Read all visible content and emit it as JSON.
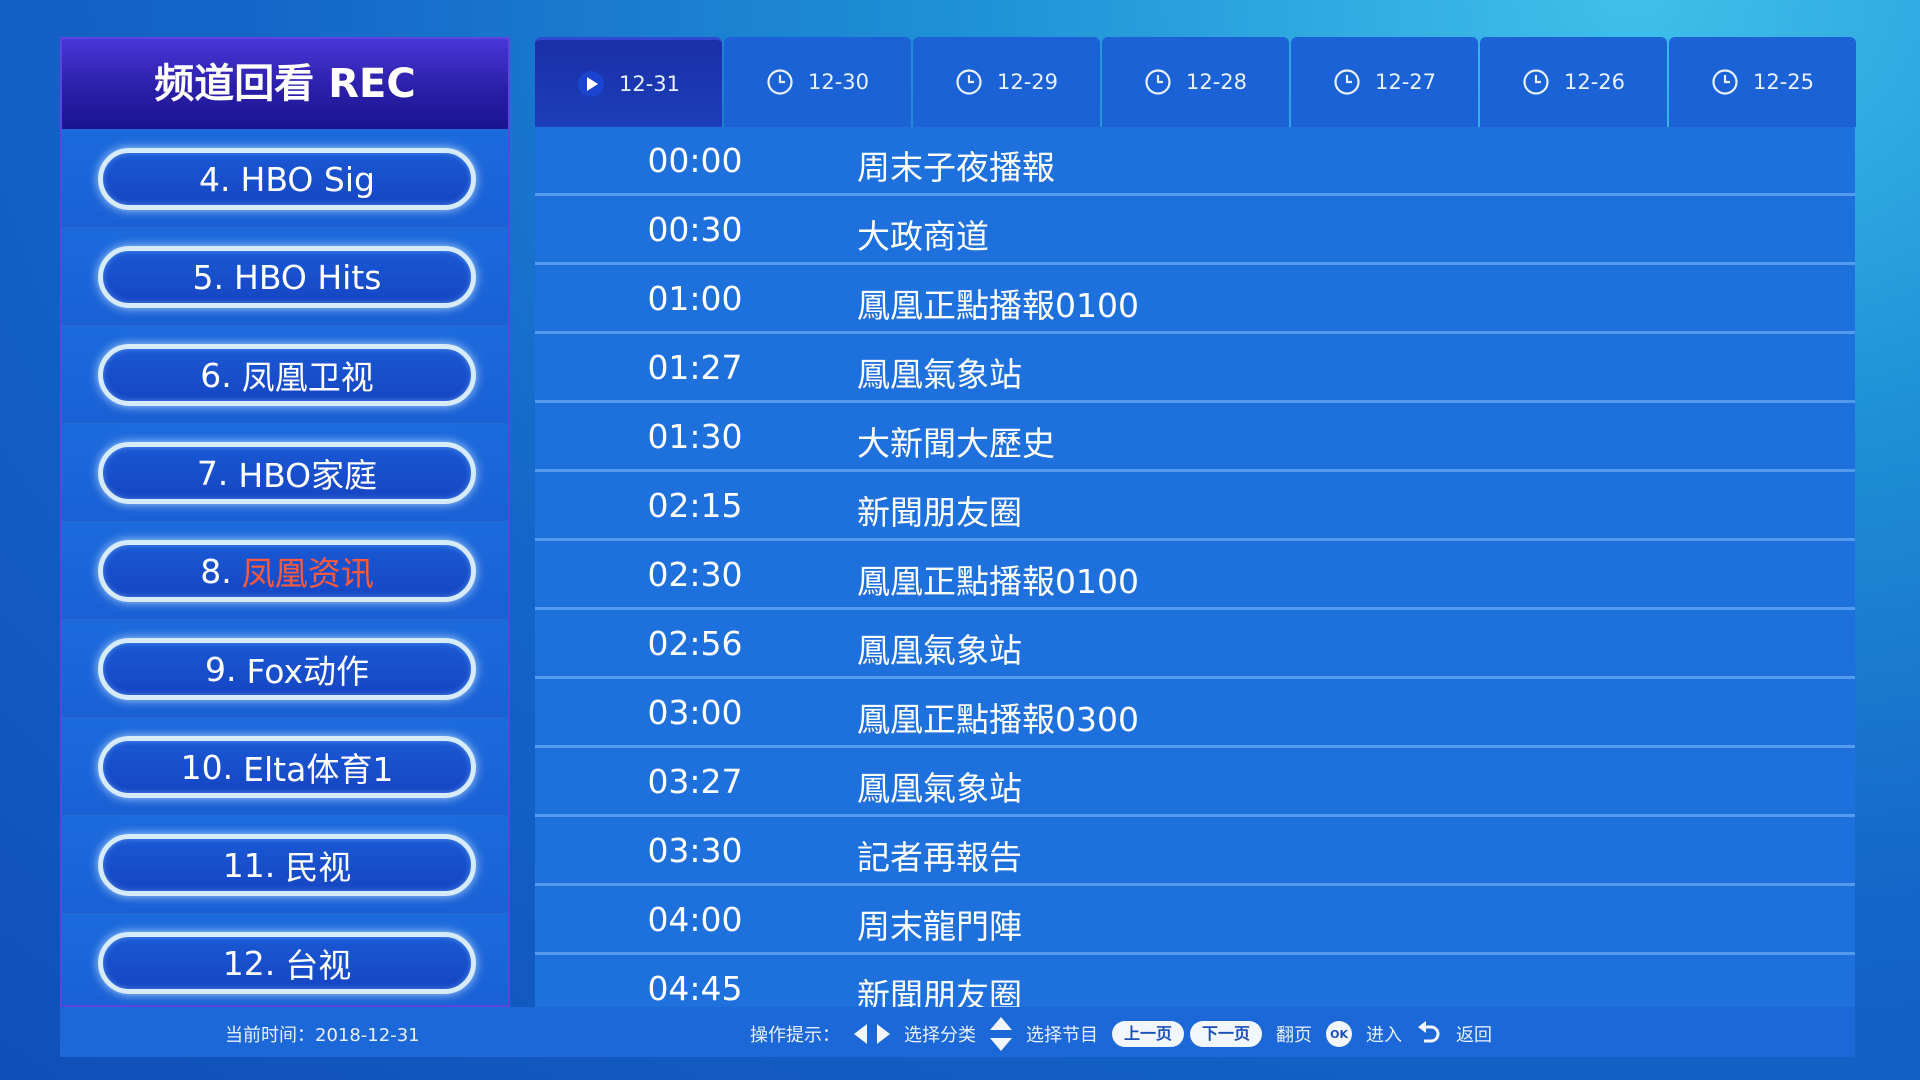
{
  "panel": {
    "title": "频道回看 REC"
  },
  "channels": [
    {
      "num": "4.",
      "name": "HBO Sig",
      "active": false
    },
    {
      "num": "5.",
      "name": "HBO Hits",
      "active": false
    },
    {
      "num": "6.",
      "name": "凤凰卫视",
      "active": false
    },
    {
      "num": "7.",
      "name": "HBO家庭",
      "active": false
    },
    {
      "num": "8.",
      "name": "凤凰资讯",
      "active": true
    },
    {
      "num": "9.",
      "name": "Fox动作",
      "active": false
    },
    {
      "num": "10.",
      "name": "Elta体育1",
      "active": false
    },
    {
      "num": "11.",
      "name": "民视",
      "active": false
    },
    {
      "num": "12.",
      "name": "台视",
      "active": false
    }
  ],
  "date_tabs": [
    {
      "label": "12-31",
      "icon": "play-icon",
      "active": true
    },
    {
      "label": "12-30",
      "icon": "clock-icon",
      "active": false
    },
    {
      "label": "12-29",
      "icon": "clock-icon",
      "active": false
    },
    {
      "label": "12-28",
      "icon": "clock-icon",
      "active": false
    },
    {
      "label": "12-27",
      "icon": "clock-icon",
      "active": false
    },
    {
      "label": "12-26",
      "icon": "clock-icon",
      "active": false
    },
    {
      "label": "12-25",
      "icon": "clock-icon",
      "active": false
    }
  ],
  "programs": [
    {
      "time": "00:00",
      "title": "周末子夜播報"
    },
    {
      "time": "00:30",
      "title": "大政商道"
    },
    {
      "time": "01:00",
      "title": "鳳凰正點播報0100"
    },
    {
      "time": "01:27",
      "title": "鳳凰氣象站"
    },
    {
      "time": "01:30",
      "title": "大新聞大歷史"
    },
    {
      "time": "02:15",
      "title": "新聞朋友圈"
    },
    {
      "time": "02:30",
      "title": "鳳凰正點播報0100"
    },
    {
      "time": "02:56",
      "title": "鳳凰氣象站"
    },
    {
      "time": "03:00",
      "title": "鳳凰正點播報0300"
    },
    {
      "time": "03:27",
      "title": "鳳凰氣象站"
    },
    {
      "time": "03:30",
      "title": "記者再報告"
    },
    {
      "time": "04:00",
      "title": "周末龍門陣"
    },
    {
      "time": "04:45",
      "title": "新聞朋友圈"
    }
  ],
  "footer": {
    "current_time": "当前时间：2018-12-31",
    "hint_label": "操作提示：",
    "hint_category": "选择分类",
    "hint_program": "选择节目",
    "page_up": "上一页",
    "page_down": "下一页",
    "hint_page": "翻页",
    "ok_label": "OK",
    "hint_enter": "进入",
    "hint_back": "返回"
  },
  "colors": {
    "active_channel_text": "#ff5a3c",
    "panel_bg": "#1a5fd4",
    "program_bg": "#1e70dc",
    "header_bg": "#2a1fa8"
  }
}
